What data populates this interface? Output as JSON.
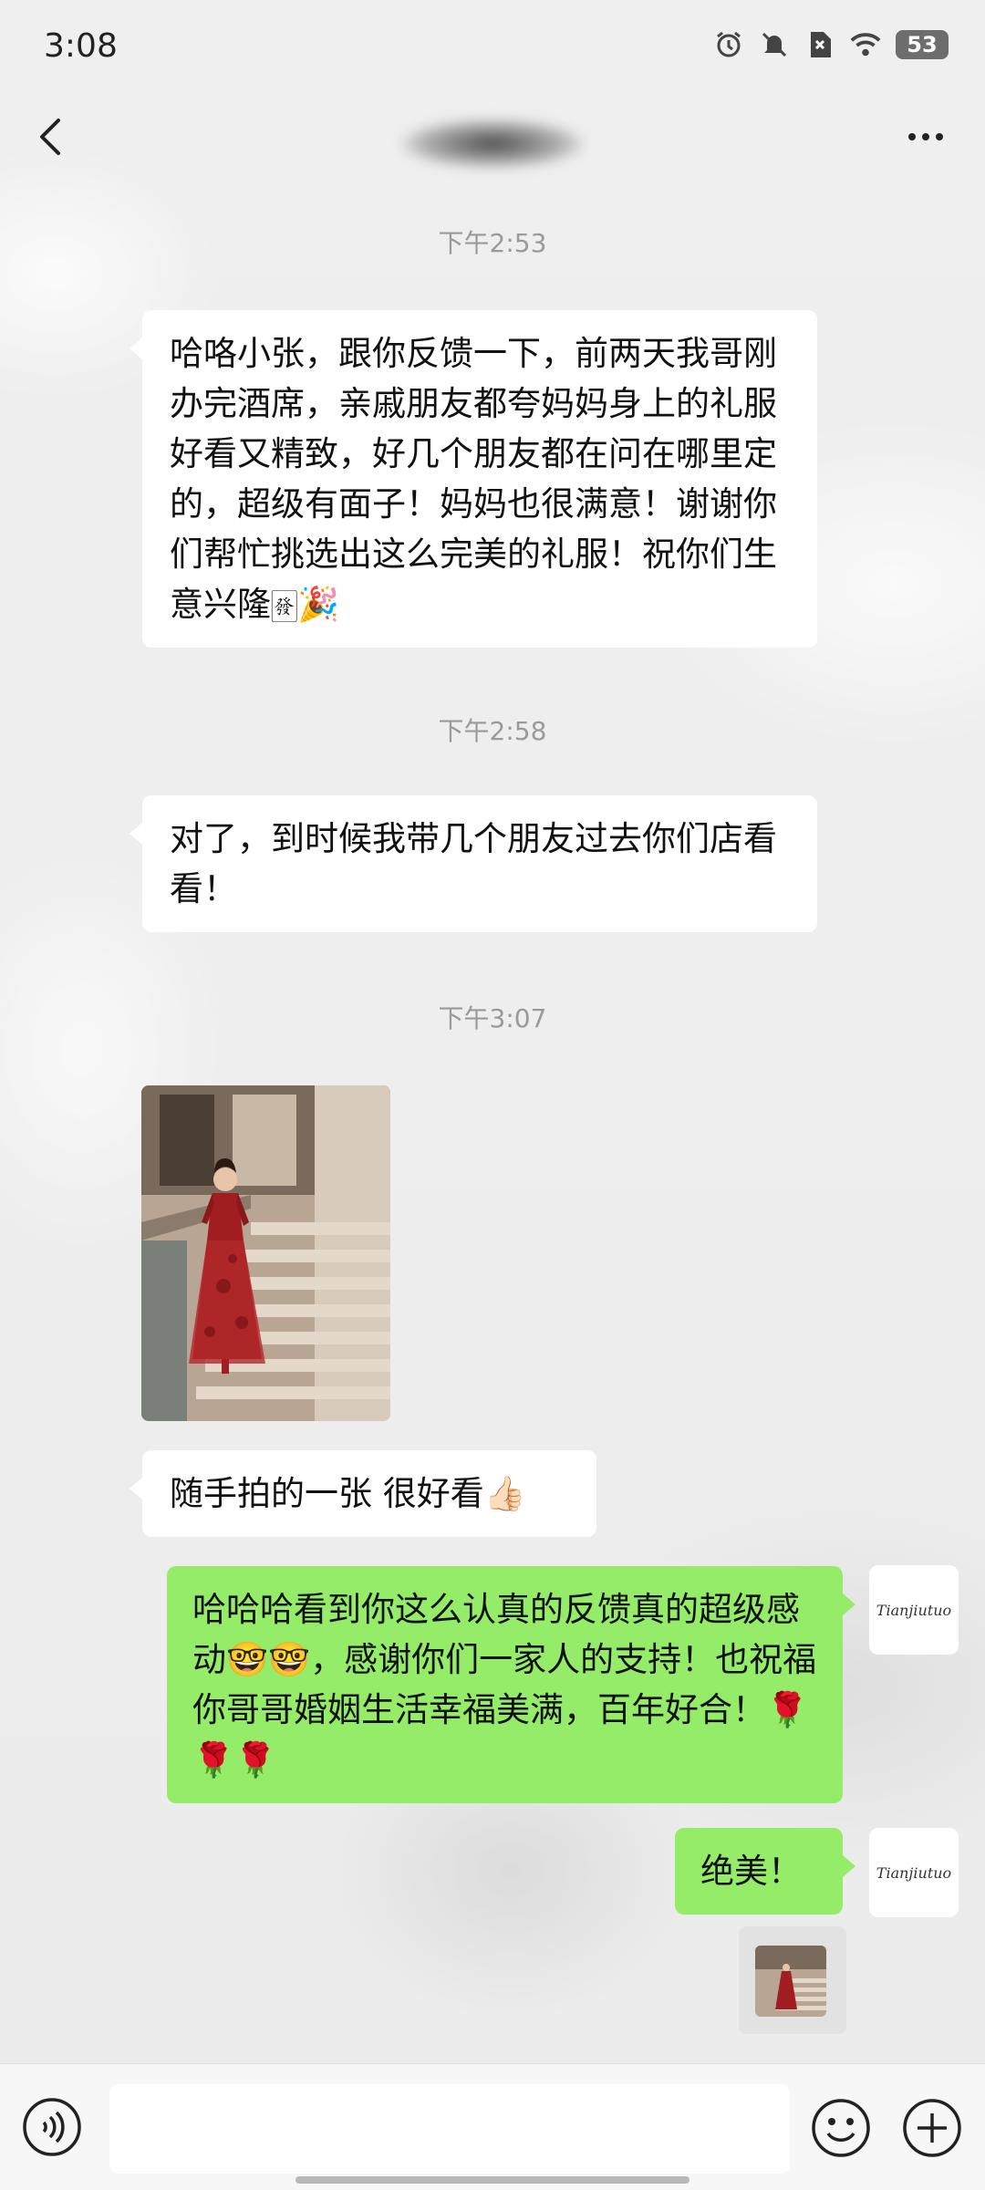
{
  "status": {
    "time": "3:08",
    "battery": "53"
  },
  "nav": {
    "back_icon": "chevron-left-icon",
    "more_icon": "more-dots-icon"
  },
  "messages": [
    {
      "type": "timestamp",
      "text": "下午2:53"
    },
    {
      "type": "text",
      "side": "in",
      "text": "哈咯小张，跟你反馈一下，前两天我哥刚办完酒席，亲戚朋友都夸妈妈身上的礼服好看又精致，好几个朋友都在问在哪里定的，超级有面子！妈妈也很满意！谢谢你们帮忙挑选出这么完美的礼服！祝你们生意兴隆🀅🎉"
    },
    {
      "type": "timestamp",
      "text": "下午2:58"
    },
    {
      "type": "text",
      "side": "in",
      "text": "对了，到时候我带几个朋友过去你们店看看！"
    },
    {
      "type": "timestamp",
      "text": "下午3:07"
    },
    {
      "type": "image",
      "side": "in",
      "description": "woman-in-red-dress-on-stairs"
    },
    {
      "type": "text",
      "side": "in",
      "text": "随手拍的一张 很好看👍🏻"
    },
    {
      "type": "text",
      "side": "out",
      "text": "哈哈哈看到你这么认真的反馈真的超级感动🤓🤓，感谢你们一家人的支持！也祝福你哥哥婚姻生活幸福美满，百年好合！🌹🌹🌹"
    },
    {
      "type": "text",
      "side": "out",
      "text": "绝美！"
    },
    {
      "type": "image",
      "side": "out",
      "description": "thumbnail-woman-in-red-dress"
    }
  ],
  "avatar": {
    "text": "Tianjiutuo"
  },
  "input": {
    "placeholder": ""
  },
  "colors": {
    "out_bubble": "#95ec69",
    "in_bubble": "#ffffff",
    "background": "#ededed"
  }
}
